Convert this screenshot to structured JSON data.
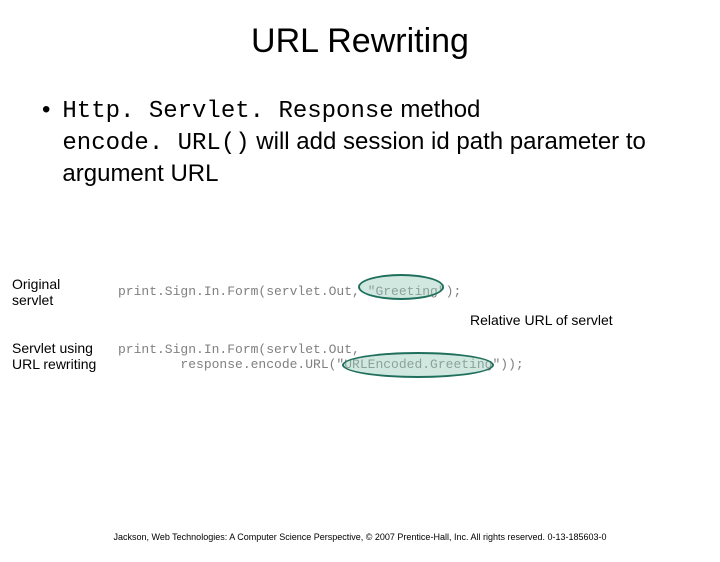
{
  "title": "URL Rewriting",
  "bullet": {
    "part1": "Http. Servlet. Response",
    "part2": " method ",
    "part3": "encode. URL()",
    "part4": " will add session id path parameter to argument URL"
  },
  "labels": {
    "original": "Original servlet",
    "rewrite": "Servlet using URL rewriting",
    "relative": "Relative URL of servlet"
  },
  "code": {
    "line1": "print.Sign.In.Form(servlet.Out, \"Greeting\");",
    "line2a": "print.Sign.In.Form(servlet.Out,",
    "line2b": "        response.encode.URL(\"URLEncoded.Greeting\"));"
  },
  "footer": "Jackson, Web Technologies: A Computer Science Perspective, © 2007 Prentice-Hall, Inc. All rights reserved. 0-13-185603-0"
}
